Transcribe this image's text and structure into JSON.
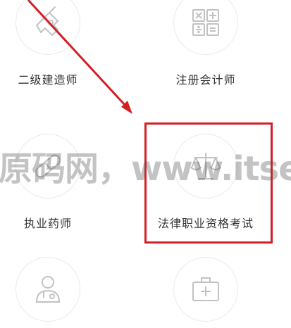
{
  "items": [
    {
      "label": "二级建造师",
      "icon": "drill-icon"
    },
    {
      "label": "注册会计师",
      "icon": "calculator-icon"
    },
    {
      "label": "执业药师",
      "icon": "pill-icon"
    },
    {
      "label": "法律职业资格考试",
      "icon": "scales-icon"
    },
    {
      "label": "",
      "icon": "doctor-icon"
    },
    {
      "label": "",
      "icon": "medical-kit-icon"
    }
  ],
  "watermark": "原码网，www.itsear.",
  "colors": {
    "highlight": "#d41f26",
    "icon": "#c2c2c2",
    "text": "#333333"
  }
}
